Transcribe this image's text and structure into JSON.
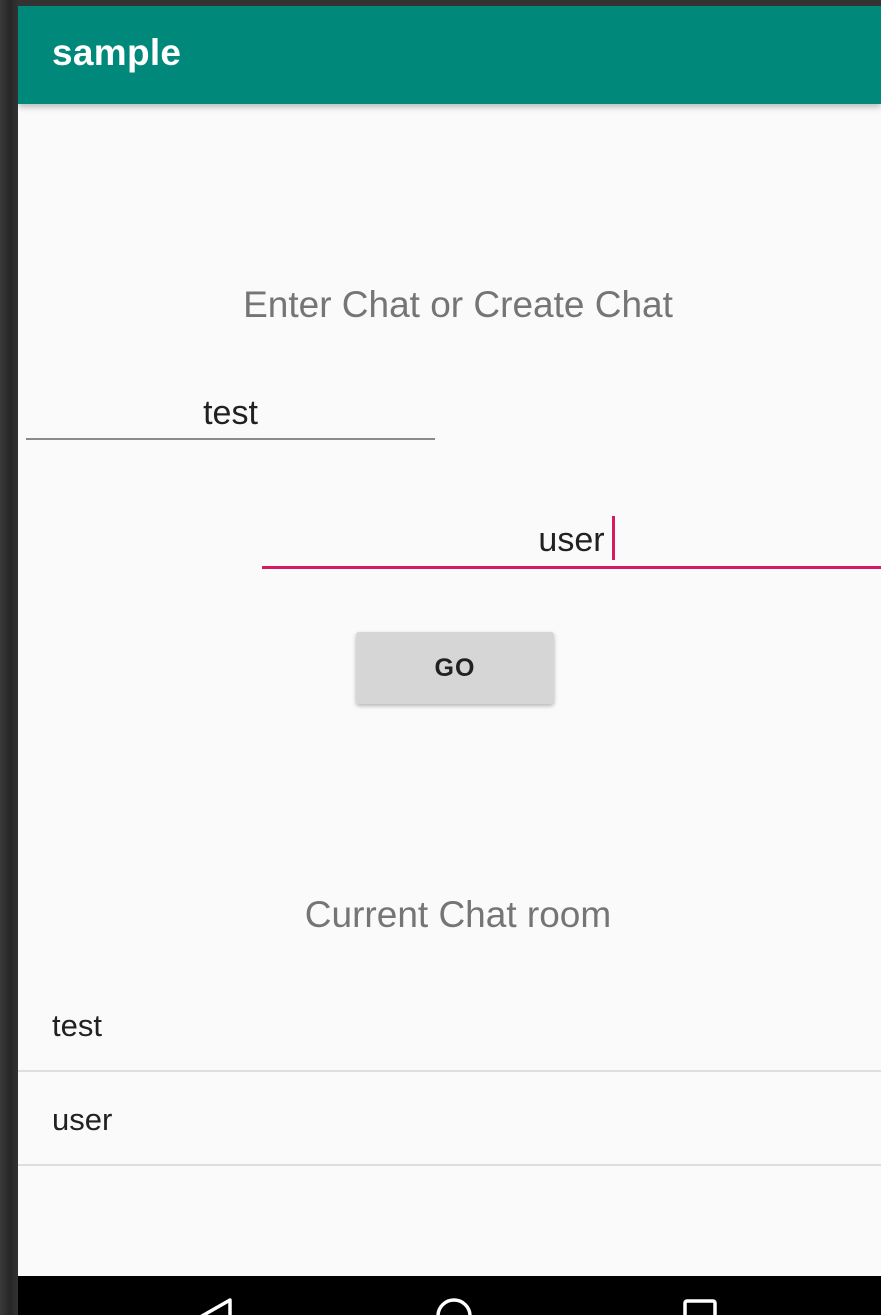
{
  "appbar": {
    "title": "sample",
    "color": "#00897b"
  },
  "main": {
    "enter_heading": "Enter Chat or Create Chat",
    "chat_input": {
      "value": "test",
      "placeholder": ""
    },
    "user_input": {
      "value": "user",
      "placeholder": ""
    },
    "go_button_label": "GO",
    "current_heading": "Current Chat room",
    "accent_color": "#d81b60"
  },
  "rooms": [
    {
      "label": "test"
    },
    {
      "label": "user"
    }
  ],
  "navbar": {
    "icons": [
      "back-icon",
      "home-icon",
      "recents-icon"
    ]
  }
}
